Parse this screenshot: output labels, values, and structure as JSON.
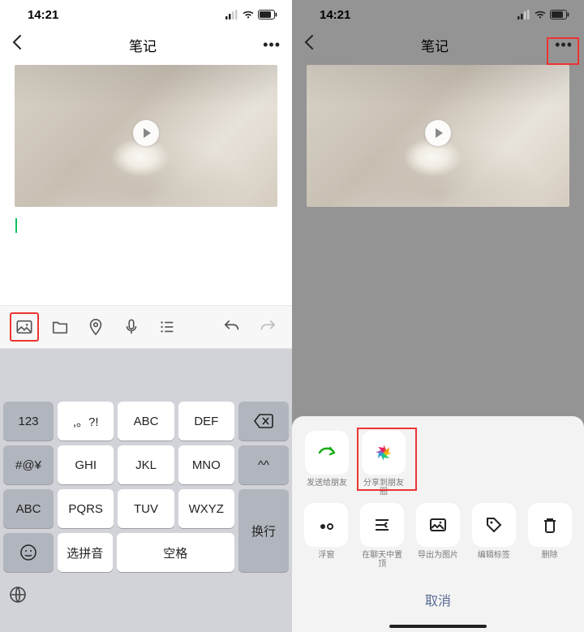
{
  "status": {
    "time": "14:21"
  },
  "nav": {
    "title": "笔记"
  },
  "toolbar": {
    "icons": [
      "image",
      "folder",
      "location",
      "mic",
      "list",
      "undo",
      "redo"
    ]
  },
  "keyboard": {
    "rows": [
      [
        "123",
        ",。?!",
        "ABC",
        "DEF",
        "backspace"
      ],
      [
        "#@¥",
        "GHI",
        "JKL",
        "MNO",
        "^^"
      ],
      [
        "ABC",
        "PQRS",
        "TUV",
        "WXYZ",
        "换行"
      ],
      [
        "smiley",
        "选拼音",
        "空格",
        ""
      ]
    ]
  },
  "sheet": {
    "row1": [
      {
        "name": "share-friend",
        "label": "发送给朋友"
      },
      {
        "name": "share-moments",
        "label": "分享到朋友圈"
      }
    ],
    "row2": [
      {
        "name": "float",
        "label": "浮窗"
      },
      {
        "name": "pin",
        "label": "在聊天中置顶"
      },
      {
        "name": "export-image",
        "label": "导出为图片"
      },
      {
        "name": "edit-tag",
        "label": "编辑标签"
      },
      {
        "name": "delete",
        "label": "删除"
      }
    ],
    "cancel": "取消"
  }
}
